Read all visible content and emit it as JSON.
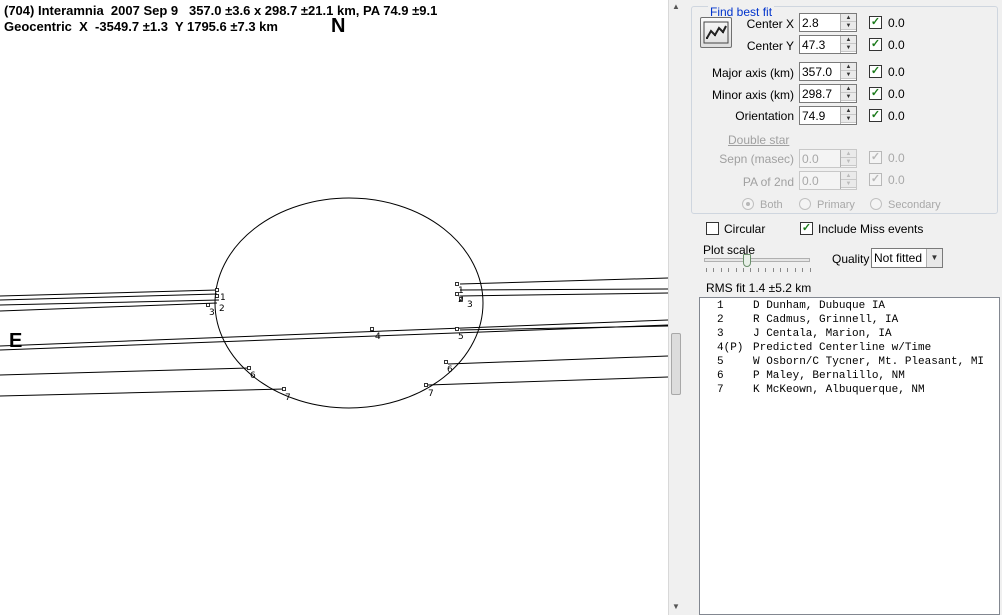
{
  "header": {
    "line1": "(704) Interamnia  2007 Sep 9   357.0 ±3.6 x 298.7 ±21.1 km, PA 74.9 ±9.1",
    "line2": "Geocentric  X  -3549.7 ±1.3  Y 1795.6 ±7.3 km"
  },
  "compass": {
    "north": "N",
    "east": "E"
  },
  "chords": [
    {
      "label": "1"
    },
    {
      "label": "2"
    },
    {
      "label": "3"
    },
    {
      "label": "4"
    },
    {
      "label": "5"
    },
    {
      "label": "6"
    },
    {
      "label": "7"
    }
  ],
  "panel": {
    "group_title": "Find best fit",
    "fit_button_icon": "chart-fit-icon",
    "params": [
      {
        "label": "Center X",
        "value": "2.8",
        "check": "0.0"
      },
      {
        "label": "Center Y",
        "value": "47.3",
        "check": "0.0"
      },
      {
        "label": "Major axis (km)",
        "value": "357.0",
        "check": "0.0"
      },
      {
        "label": "Minor axis (km)",
        "value": "298.7",
        "check": "0.0"
      },
      {
        "label": "Orientation",
        "value": "74.9",
        "check": "0.0"
      }
    ],
    "double_star": {
      "link": "Double star",
      "sepn_label": "Sepn (masec)",
      "sepn_value": "0.0",
      "sepn_check": "0.0",
      "pa_label": "PA of 2nd",
      "pa_value": "0.0",
      "pa_check": "0.0",
      "radios": [
        "Both",
        "Primary",
        "Secondary"
      ]
    },
    "circular_label": "Circular",
    "include_miss_label": "Include Miss events",
    "plot_scale_label": "Plot scale",
    "quality_label": "Quality",
    "quality_value": "Not fitted",
    "rms": "RMS fit 1.4 ±5.2 km",
    "observers": [
      {
        "n": "1",
        "text": "D Dunham, Dubuque IA"
      },
      {
        "n": "2",
        "text": "R Cadmus, Grinnell, IA"
      },
      {
        "n": "3",
        "text": "J Centala, Marion, IA"
      },
      {
        "n": "4(P)",
        "text": "Predicted Centerline w/Time"
      },
      {
        "n": "5",
        "text": "W Osborn/C Tycner, Mt. Pleasant, MI"
      },
      {
        "n": "6",
        "text": "P Maley, Bernalillo, NM"
      },
      {
        "n": "7",
        "text": "K McKeown, Albuquerque, NM"
      }
    ]
  }
}
